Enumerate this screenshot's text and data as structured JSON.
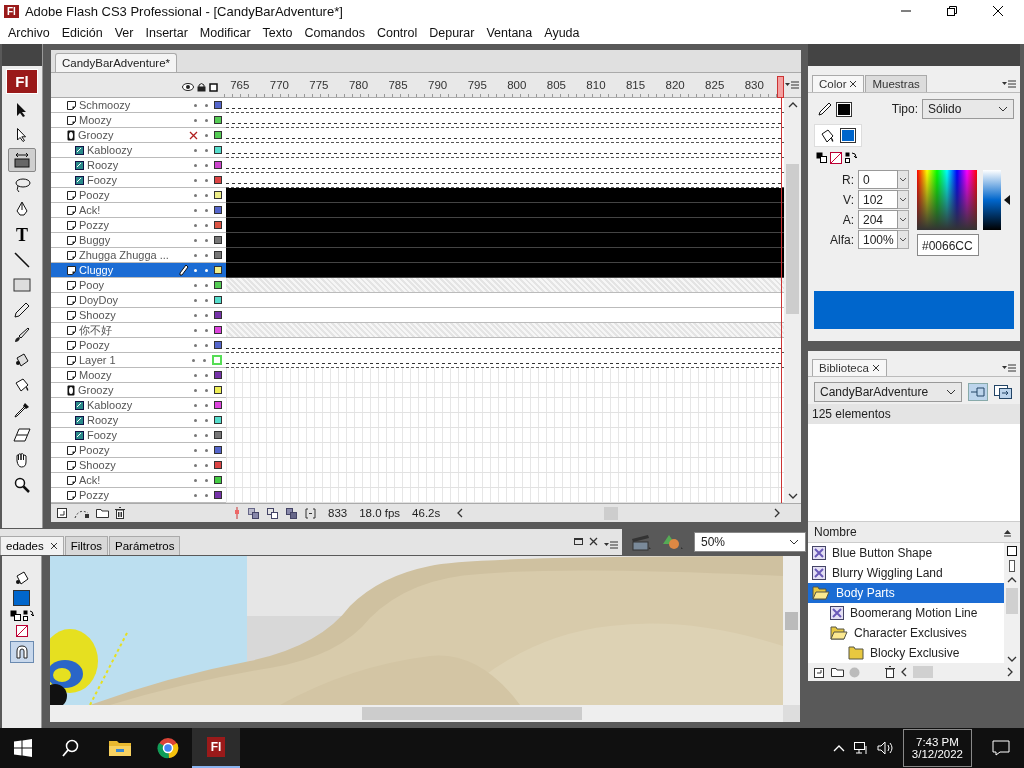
{
  "window": {
    "title": "Adobe Flash CS3 Professional - [CandyBarAdventure*]",
    "app_logo": "Fl"
  },
  "menu": [
    "Archivo",
    "Edición",
    "Ver",
    "Insertar",
    "Modificar",
    "Texto",
    "Comandos",
    "Control",
    "Depurar",
    "Ventana",
    "Ayuda"
  ],
  "tools": [
    {
      "kind": "arrow",
      "selected": false
    },
    {
      "kind": "subselect",
      "selected": false
    },
    {
      "kind": "transform",
      "selected": true
    },
    {
      "kind": "lasso",
      "selected": false
    },
    {
      "kind": "pen",
      "selected": false
    },
    {
      "kind": "text",
      "label": "T",
      "selected": false
    },
    {
      "kind": "line",
      "selected": false
    },
    {
      "kind": "rect",
      "selected": false
    },
    {
      "kind": "pencil",
      "selected": false
    },
    {
      "kind": "brush",
      "selected": false
    },
    {
      "kind": "inkbottle",
      "selected": false
    },
    {
      "kind": "bucket",
      "selected": false
    },
    {
      "kind": "eyedropper",
      "selected": false
    },
    {
      "kind": "eraser",
      "selected": false
    },
    {
      "kind": "hand",
      "selected": false
    },
    {
      "kind": "zoom",
      "selected": false
    }
  ],
  "toolbar_logo": "Fl",
  "toolbar_colors": {
    "swatches": [
      {
        "kind": "fill",
        "color": "#0066cc"
      }
    ],
    "snap_on": true
  },
  "timeline": {
    "tab": "CandyBarAdventure*",
    "ruler": [
      "765",
      "770",
      "775",
      "780",
      "785",
      "790",
      "795",
      "800",
      "805",
      "810",
      "815",
      "820",
      "825",
      "830"
    ],
    "layers": [
      {
        "name": "Schmoozy",
        "kind": "normal",
        "color": "#5566cc",
        "hidden": false,
        "outline": false,
        "selected": false,
        "frames": {
          "kind": "dashed"
        }
      },
      {
        "name": "Moozy",
        "kind": "normal",
        "color": "#55cc55",
        "hidden": false,
        "outline": false,
        "selected": false,
        "frames": {
          "kind": "dashed"
        }
      },
      {
        "name": "Groozy",
        "kind": "guide",
        "color": "#55cc55",
        "hidden": true,
        "outline": false,
        "selected": false,
        "frames": {
          "kind": "dashed"
        },
        "children": [
          {
            "name": "Kabloozy",
            "kind": "guided",
            "color": "#55ddcc",
            "hidden": false,
            "outline": false,
            "selected": false,
            "frames": {
              "kind": "dashed"
            }
          },
          {
            "name": "Roozy",
            "kind": "guided",
            "color": "#cc44cc",
            "hidden": false,
            "outline": false,
            "selected": false,
            "frames": {
              "kind": "dashed"
            }
          },
          {
            "name": "Foozy",
            "kind": "guided",
            "color": "#dd4444",
            "hidden": false,
            "outline": false,
            "selected": false,
            "frames": {
              "kind": "dashed"
            }
          }
        ]
      },
      {
        "name": "Poozy",
        "kind": "normal",
        "color": "#eeee88",
        "hidden": false,
        "outline": false,
        "selected": false,
        "frames": {
          "kind": "filled"
        }
      },
      {
        "name": "Ack!",
        "kind": "normal",
        "color": "#5566cc",
        "hidden": false,
        "outline": false,
        "selected": false,
        "frames": {
          "kind": "filled"
        }
      },
      {
        "name": "Pozzy",
        "kind": "normal",
        "color": "#dd5544",
        "hidden": false,
        "outline": false,
        "selected": false,
        "frames": {
          "kind": "filled"
        }
      },
      {
        "name": "Buggy",
        "kind": "normal",
        "color": "#777777",
        "hidden": false,
        "outline": false,
        "selected": false,
        "frames": {
          "kind": "filled"
        }
      },
      {
        "name": "Zhugga Zhugga ...",
        "kind": "normal",
        "color": "#777777",
        "hidden": false,
        "outline": false,
        "selected": false,
        "frames": {
          "kind": "filled"
        }
      },
      {
        "name": "Cluggy",
        "kind": "normal",
        "color": "#eeee88",
        "hidden": false,
        "outline": false,
        "selected": true,
        "frames": {
          "kind": "filled"
        }
      },
      {
        "name": "Pooy",
        "kind": "normal",
        "color": "#55cc55",
        "hidden": false,
        "outline": false,
        "selected": false,
        "frames": {
          "kind": "hatched"
        }
      },
      {
        "name": "DoyDoy",
        "kind": "normal",
        "color": "#55ddcc",
        "hidden": false,
        "outline": false,
        "selected": false,
        "frames": {
          "kind": "white"
        }
      },
      {
        "name": "Shoozy",
        "kind": "normal",
        "color": "#7733aa",
        "hidden": false,
        "outline": false,
        "selected": false,
        "frames": {
          "kind": "white"
        }
      },
      {
        "name": "你不好",
        "kind": "normal",
        "color": "#dd44dd",
        "hidden": false,
        "outline": false,
        "selected": false,
        "frames": {
          "kind": "hatched"
        }
      },
      {
        "name": "Poozy",
        "kind": "normal",
        "color": "#5566cc",
        "hidden": false,
        "outline": false,
        "selected": false,
        "frames": {
          "kind": "dashed"
        }
      },
      {
        "name": "Layer 1",
        "kind": "normal",
        "color": "#55dd55",
        "hidden": false,
        "outline": true,
        "selected": false,
        "frames": {
          "kind": "dashed"
        }
      },
      {
        "name": "Moozy",
        "kind": "normal",
        "color": "#7733aa",
        "hidden": false,
        "outline": false,
        "selected": false,
        "frames": {
          "kind": "empty"
        }
      },
      {
        "name": "Groozy",
        "kind": "guide",
        "color": "#eeee55",
        "hidden": false,
        "outline": false,
        "selected": false,
        "frames": {
          "kind": "empty"
        },
        "children": [
          {
            "name": "Kabloozy",
            "kind": "guided",
            "color": "#dd44dd",
            "hidden": false,
            "outline": false,
            "selected": false,
            "frames": {
              "kind": "empty"
            }
          },
          {
            "name": "Roozy",
            "kind": "guided",
            "color": "#55ddcc",
            "hidden": false,
            "outline": false,
            "selected": false,
            "frames": {
              "kind": "empty"
            }
          },
          {
            "name": "Foozy",
            "kind": "guided",
            "color": "#777777",
            "hidden": false,
            "outline": false,
            "selected": false,
            "frames": {
              "kind": "empty"
            }
          }
        ]
      },
      {
        "name": "Poozy",
        "kind": "normal",
        "color": "#5566cc",
        "hidden": false,
        "outline": false,
        "selected": false,
        "frames": {
          "kind": "empty"
        }
      },
      {
        "name": "Shoozy",
        "kind": "normal",
        "color": "#dd4444",
        "hidden": false,
        "outline": false,
        "selected": false,
        "frames": {
          "kind": "empty"
        }
      },
      {
        "name": "Ack!",
        "kind": "normal",
        "color": "#44cc44",
        "hidden": false,
        "outline": false,
        "selected": false,
        "frames": {
          "kind": "empty"
        }
      },
      {
        "name": "Pozzy",
        "kind": "normal",
        "color": "#7733aa",
        "hidden": false,
        "outline": false,
        "selected": false,
        "frames": {
          "kind": "empty"
        }
      }
    ],
    "frame": "833",
    "fps": "18.0 fps",
    "time": "46.2s"
  },
  "properties": {
    "tabs": [
      {
        "label": "edades",
        "selected": true
      },
      {
        "label": "Filtros",
        "selected": false
      },
      {
        "label": "Parámetros",
        "selected": false
      }
    ],
    "zoom": "50%"
  },
  "color_panel": {
    "tabs": [
      {
        "label": "Color",
        "selected": true
      },
      {
        "label": "Muestras",
        "selected": false
      }
    ],
    "swatches": [
      {
        "kind": "stroke",
        "color": "#000000"
      },
      {
        "kind": "fill",
        "color": "#0066cc"
      },
      {
        "kind": "preview",
        "color": "#0066cc"
      }
    ],
    "type_label": "Tipo:",
    "type": "Sólido",
    "brightness": {
      "level": 0.5
    },
    "fields": [
      {
        "label": "R:",
        "value": "0"
      },
      {
        "label": "V:",
        "value": "102"
      },
      {
        "label": "A:",
        "value": "204"
      },
      {
        "label": "Alfa:",
        "value": "100%"
      }
    ],
    "hex": "#0066CC"
  },
  "library": {
    "tab": "Biblioteca",
    "document": "CandyBarAdventure",
    "count": "125 elementos",
    "column": "Nombre",
    "items": [
      {
        "name": "Blue Button Shape",
        "kind": "symbol",
        "selected": false
      },
      {
        "name": "Blurry Wiggling Land",
        "kind": "symbol",
        "selected": false
      },
      {
        "name": "Body Parts",
        "kind": "folder",
        "expanded": true,
        "selected": true,
        "children": [
          {
            "name": "Boomerang Motion Line",
            "kind": "symbol",
            "selected": false
          },
          {
            "name": "Character Exclusives",
            "kind": "folder",
            "expanded": true,
            "selected": false,
            "children": [
              {
                "name": "Blocky Exclusive",
                "kind": "folder",
                "expanded": false,
                "selected": false
              }
            ]
          }
        ]
      }
    ]
  },
  "taskbar": {
    "apps": [
      {
        "kind": "folder",
        "selected": false
      },
      {
        "kind": "browser",
        "selected": false
      },
      {
        "kind": "flash",
        "label": "Fl",
        "selected": true
      }
    ],
    "time": "7:43 PM",
    "date": "3/12/2022"
  }
}
